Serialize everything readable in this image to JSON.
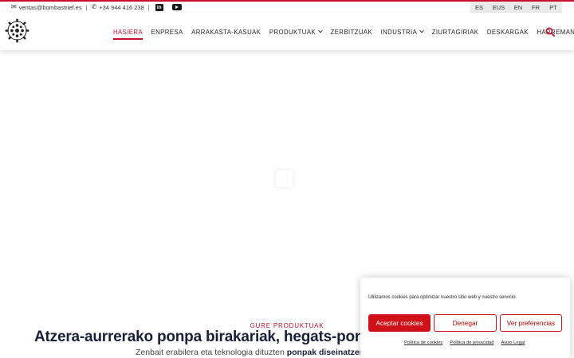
{
  "topbar": {
    "email": "ventas@bombastrief.es",
    "phone": "+34 944 416 238",
    "separator": "|",
    "linkedin_glyph": "in"
  },
  "languages": [
    "ES",
    "EUS",
    "EN",
    "FR",
    "PT"
  ],
  "nav": {
    "items": [
      {
        "label": "HASIERA",
        "active": true,
        "dropdown": false
      },
      {
        "label": "ENPRESA",
        "active": false,
        "dropdown": false
      },
      {
        "label": "ARRAKASTA-KASUAK",
        "active": false,
        "dropdown": false
      },
      {
        "label": "PRODUKTUAK",
        "active": false,
        "dropdown": true
      },
      {
        "label": "ZERBITZUAK",
        "active": false,
        "dropdown": false
      },
      {
        "label": "INDUSTRIA",
        "active": false,
        "dropdown": true
      },
      {
        "label": "ZIURTAGIRIAK",
        "active": false,
        "dropdown": false
      },
      {
        "label": "DESKARGAK",
        "active": false,
        "dropdown": false
      },
      {
        "label": "HARREMANETAN",
        "active": false,
        "dropdown": false
      }
    ]
  },
  "section": {
    "eyebrow": "GURE PRODUKTUAK",
    "headline": "Atzera-aurrerako ponpa birakariak, hegats-ponp",
    "sub_plain": "Zenbait erabilera eta teknologia dituzten ",
    "sub_bold": "ponpak diseinatzen"
  },
  "cookie": {
    "message": "Utilizamos cookies para optimizar nuestro sitio web y nuestro servicio.",
    "accept": "Aceptar cookies",
    "deny": "Denegar",
    "prefs": "Ver preferencias",
    "links": [
      "Política de cookies",
      "Política de privacidad",
      "Aviso Legal"
    ]
  },
  "colors": {
    "accent": "#c8102e",
    "navy": "#1a1f3a"
  },
  "icons": {
    "email": "envelope-icon",
    "phone": "phone-icon",
    "linkedin": "linkedin-icon",
    "youtube": "youtube-icon",
    "search": "search-icon",
    "logo": "gear-logo"
  }
}
